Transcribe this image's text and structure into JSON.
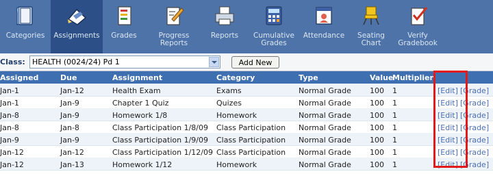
{
  "toolbar": {
    "items": [
      {
        "label": "Categories",
        "icon": "categories-book-icon"
      },
      {
        "label": "Assignments",
        "icon": "assignments-pencil-icon"
      },
      {
        "label": "Grades",
        "icon": "grades-sheet-icon"
      },
      {
        "label": "Progress Reports",
        "icon": "progress-reports-icon"
      },
      {
        "label": "Reports",
        "icon": "printer-icon"
      },
      {
        "label": "Cumulative Grades",
        "icon": "calculator-icon"
      },
      {
        "label": "Attendance",
        "icon": "attendance-icon"
      },
      {
        "label": "Seating Chart",
        "icon": "chair-icon"
      },
      {
        "label": "Verify Gradebook",
        "icon": "verify-check-icon"
      }
    ],
    "active": "Assignments"
  },
  "classbar": {
    "label": "Class:",
    "selected": "HEALTH (0024/24) Pd 1",
    "add_label": "Add New"
  },
  "table": {
    "headers": {
      "assigned": "Assigned",
      "due": "Due",
      "assignment": "Assignment",
      "category": "Category",
      "type": "Type",
      "value": "Value",
      "multiplier": "Multiplier"
    },
    "edit_label": "[Edit]",
    "grade_label": "[Grade]",
    "rows": [
      {
        "assigned": "Jan-1",
        "due": "Jan-12",
        "assignment": "Health Exam",
        "category": "Exams",
        "type": "Normal Grade",
        "value": "100",
        "multiplier": "1"
      },
      {
        "assigned": "Jan-1",
        "due": "Jan-9",
        "assignment": "Chapter 1 Quiz",
        "category": "Quizes",
        "type": "Normal Grade",
        "value": "100",
        "multiplier": "1"
      },
      {
        "assigned": "Jan-8",
        "due": "Jan-9",
        "assignment": "Homework 1/8",
        "category": "Homework",
        "type": "Normal Grade",
        "value": "100",
        "multiplier": "1"
      },
      {
        "assigned": "Jan-8",
        "due": "Jan-8",
        "assignment": "Class Participation 1/8/09",
        "category": "Class Participation",
        "type": "Normal Grade",
        "value": "100",
        "multiplier": "1"
      },
      {
        "assigned": "Jan-9",
        "due": "Jan-9",
        "assignment": "Class Participation 1/9/09",
        "category": "Class Participation",
        "type": "Normal Grade",
        "value": "100",
        "multiplier": "1"
      },
      {
        "assigned": "Jan-12",
        "due": "Jan-12",
        "assignment": "Class Participation 1/12/09",
        "category": "Class Participation",
        "type": "Normal Grade",
        "value": "100",
        "multiplier": "1"
      },
      {
        "assigned": "Jan-12",
        "due": "Jan-13",
        "assignment": "Homework 1/12",
        "category": "Homework",
        "type": "Normal Grade",
        "value": "100",
        "multiplier": "1"
      }
    ]
  },
  "colors": {
    "toolbar": "#4d73a8",
    "toolbar_active": "#2b4f86",
    "header": "#3e6fb0",
    "highlight": "#e21a1a",
    "link": "#4a6fb3"
  }
}
